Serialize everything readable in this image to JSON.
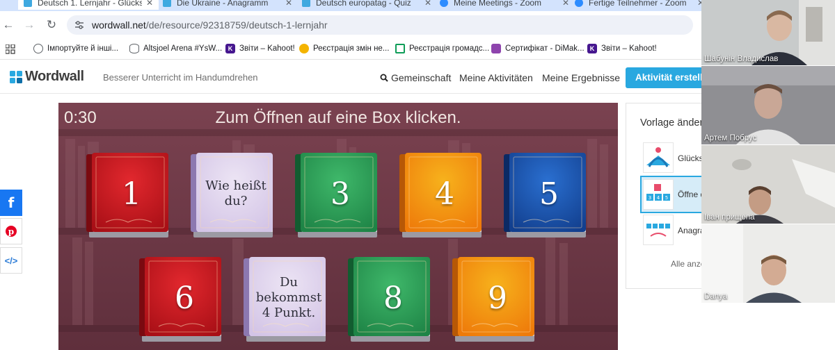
{
  "browser": {
    "tabs": [
      {
        "title": "Deutsch 1. Lernjahr - Glücks",
        "favicon_color": "#3fa9e0"
      },
      {
        "title": "Die Ukraine - Anagramm",
        "favicon_color": "#3fa9e0"
      },
      {
        "title": "Deutsch europatag - Quiz",
        "favicon_color": "#3fa9e0"
      },
      {
        "title": "Meine Meetings - Zoom",
        "favicon_color": "#2d8cff"
      },
      {
        "title": "Fertige Teilnehmer - Zoom",
        "favicon_color": "#2d8cff"
      }
    ],
    "url_host": "wordwall.net",
    "url_path": "/de/resource/92318759/deutsch-1-lernjahr",
    "bookmarks": [
      {
        "label": "Імпортуйте й інші...",
        "icon": "globe-icon",
        "color": "#5f6368"
      },
      {
        "label": "Altsjoel Arena #YsW...",
        "icon": "stack-icon",
        "color": "#5f6368"
      },
      {
        "label": "Звіти – Kahoot!",
        "icon": "kahoot-icon",
        "color": "#46178f"
      },
      {
        "label": "Реєстрація змін не...",
        "icon": "bulb-icon",
        "color": "#f4b400"
      },
      {
        "label": "Реєстрація громадс...",
        "icon": "doc-icon",
        "color": "#0f9d58"
      },
      {
        "label": "Сертифікат - DiMak...",
        "icon": "cert-icon",
        "color": "#8e44ad"
      },
      {
        "label": "Звіти – Kahoot!",
        "icon": "kahoot-icon",
        "color": "#46178f"
      }
    ]
  },
  "wordwall": {
    "logo": "Wordwall",
    "tagline": "Besserer Unterricht im Handumdrehen",
    "nav": [
      "Gemeinschaft",
      "Meine Aktivitäten",
      "Meine Ergebnisse"
    ],
    "cta": "Aktivität erstellen"
  },
  "game": {
    "timer": "0:30",
    "instruction": "Zum Öffnen auf eine Box klicken.",
    "boxes": [
      {
        "label": "1",
        "state": "closed",
        "color": "red"
      },
      {
        "label": "Wie heißt du?",
        "state": "open",
        "color": "lavender"
      },
      {
        "label": "3",
        "state": "closed",
        "color": "green"
      },
      {
        "label": "4",
        "state": "closed",
        "color": "orange"
      },
      {
        "label": "5",
        "state": "closed",
        "color": "blue"
      },
      {
        "label": "6",
        "state": "closed",
        "color": "red"
      },
      {
        "label": "Du bekommst 4 Punkt.",
        "state": "open",
        "color": "lavender"
      },
      {
        "label": "8",
        "state": "closed",
        "color": "green"
      },
      {
        "label": "9",
        "state": "closed",
        "color": "orange"
      }
    ]
  },
  "template_panel": {
    "title": "Vorlage ändern",
    "items": [
      {
        "name": "Glücksrad",
        "selected": false
      },
      {
        "name": "Öffne die Box",
        "selected": true
      },
      {
        "name": "Anagramm",
        "selected": false
      }
    ],
    "more": "Alle anzeigen"
  },
  "participants": [
    {
      "name": "Шабунін Владислав"
    },
    {
      "name": "Артем Побрус"
    },
    {
      "name": "Іван прищепа"
    },
    {
      "name": "Danya"
    }
  ],
  "colors": {
    "accent": "#29a8e0",
    "game_bg": "#6b3846",
    "red": "#c0161c",
    "green": "#1f8f4a",
    "orange": "#f07f0c",
    "blue": "#134fa0",
    "lavender": "#d9cde8"
  }
}
